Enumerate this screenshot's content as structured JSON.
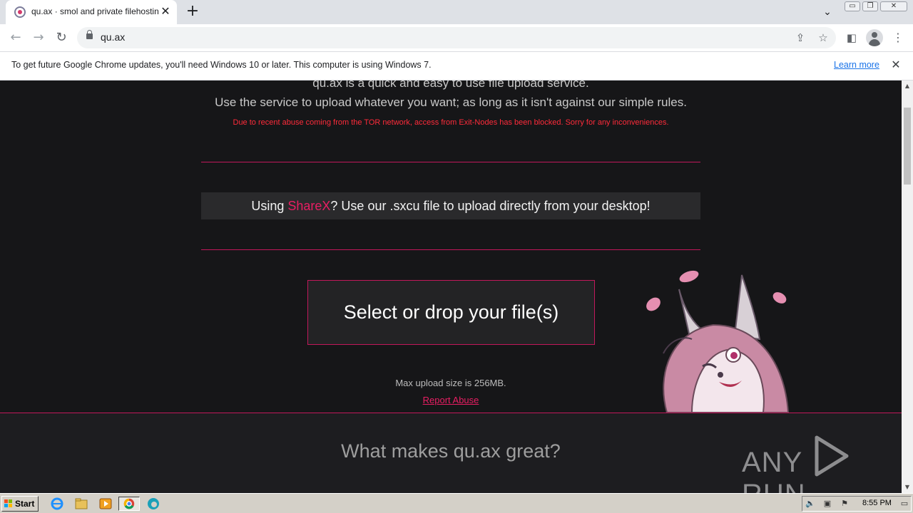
{
  "browser": {
    "tab_title": "qu.ax · smol and private filehosting",
    "url": "qu.ax",
    "new_tab_symbol": "+",
    "close_symbol": "✕"
  },
  "infobar": {
    "message": "To get future Google Chrome updates, you'll need Windows 10 or later. This computer is using Windows 7.",
    "link": "Learn more"
  },
  "page": {
    "intro_line1": "qu.ax is a quick and easy to use file upload service.",
    "intro_line2": "Use the service to upload whatever you want; as long as it isn't against our simple rules.",
    "tor_notice": "Due to recent abuse coming from the TOR network, access from Exit-Nodes has been blocked. Sorry for any inconveniences.",
    "sharex_prefix": "Using ",
    "sharex_link": "ShareX",
    "sharex_suffix": "? Use our .sxcu file to upload directly from your desktop!",
    "dropzone_label": "Select or drop your file(s)",
    "max_upload": "Max upload size is 256MB.",
    "report_abuse": "Report Abuse",
    "section_title": "What makes qu.ax great?",
    "accent_color": "#e91e63"
  },
  "watermark": {
    "text_left": "ANY",
    "text_right": "RUN"
  },
  "taskbar": {
    "start_label": "Start",
    "clock": "8:55 PM"
  }
}
